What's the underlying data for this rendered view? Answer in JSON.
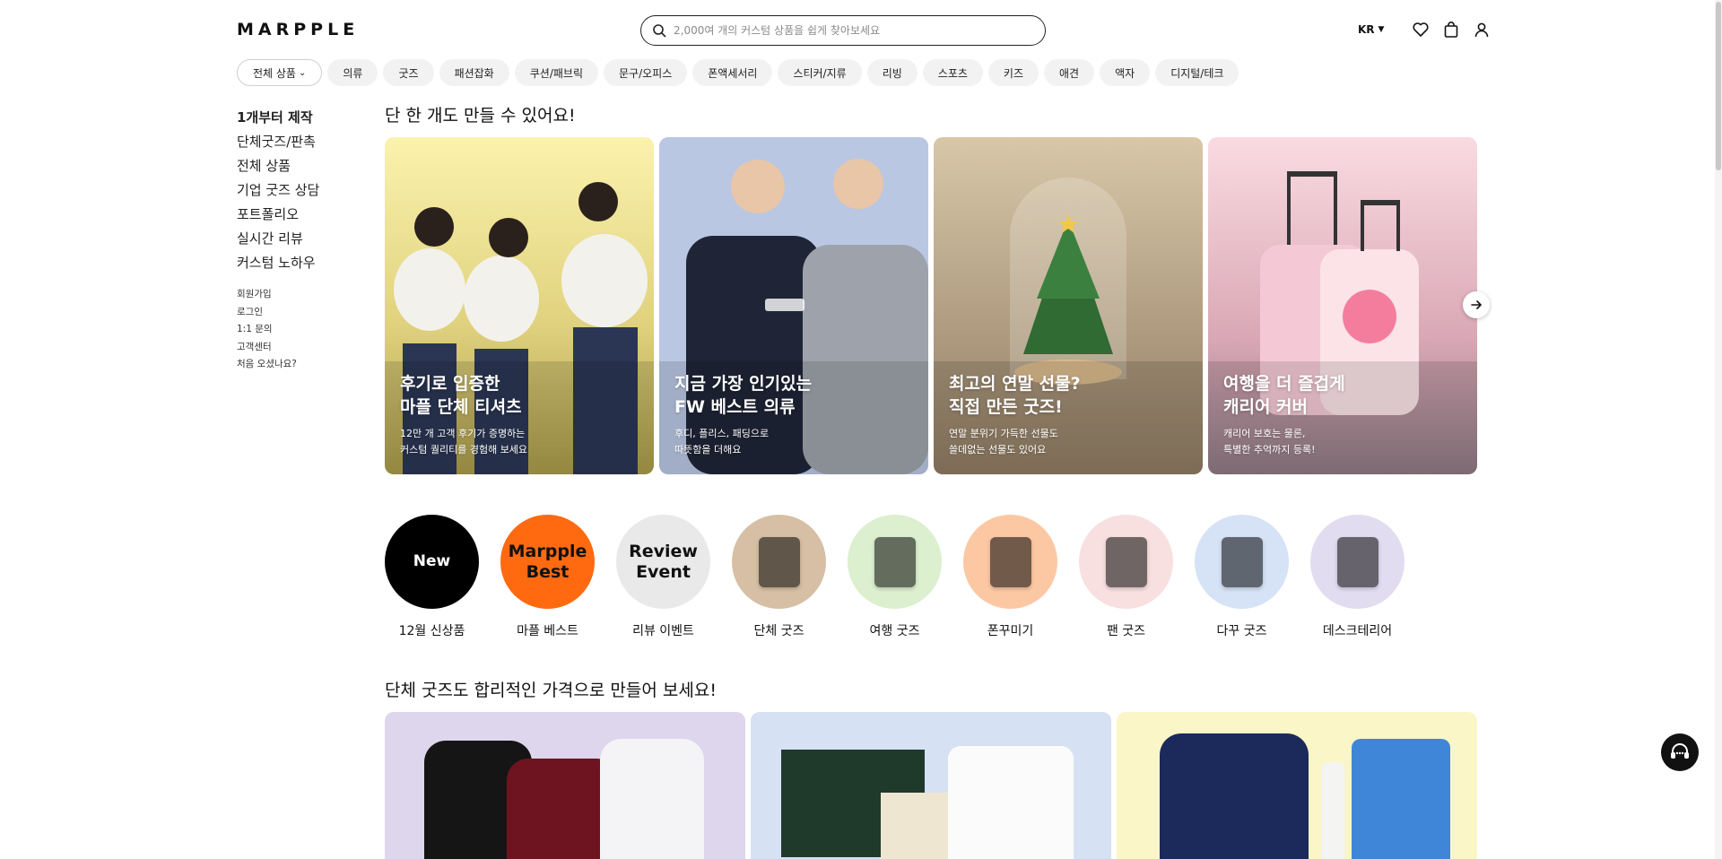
{
  "header": {
    "logo": "MARPPLE",
    "search_placeholder": "2,000여 개의 커스텀 상품을 쉽게 찾아보세요",
    "lang": "KR"
  },
  "categories": {
    "all_label": "전체 상품",
    "items": [
      "의류",
      "굿즈",
      "패션잡화",
      "쿠션/패브릭",
      "문구/오피스",
      "폰액세서리",
      "스티커/지류",
      "리빙",
      "스포츠",
      "키즈",
      "애견",
      "액자",
      "디지털/테크"
    ]
  },
  "sidebar": {
    "main": [
      "1개부터 제작",
      "단체굿즈/판촉",
      "전체 상품",
      "기업 굿즈 상담",
      "포트폴리오",
      "실시간 리뷰",
      "커스텀 노하우"
    ],
    "sub": [
      "회원가입",
      "로그인",
      "1:1 문의",
      "고객센터",
      "처음 오셨나요?"
    ]
  },
  "section1": {
    "title": "단 한 개도 만들 수 있어요!",
    "banners": [
      {
        "heading": "후기로 입증한\n마플 단체 티셔츠",
        "desc": "12만 개 고객 후기가 증명하는\n커스텀 퀄리티를 경험해 보세요"
      },
      {
        "heading": "지금 가장 인기있는\nFW 베스트 의류",
        "desc": "후디, 플리스, 패딩으로\n따뜻함을 더해요"
      },
      {
        "heading": "최고의 연말 선물?\n직접 만든 굿즈!",
        "desc": "연말 분위기 가득한 선물도\n쓸데없는 선물도 있어요"
      },
      {
        "heading": "여행을 더 즐겁게\n캐리어 커버",
        "desc": "캐리어 보호는 물론,\n특별한 추억까지 등록!"
      }
    ]
  },
  "circles": [
    {
      "inner": "New",
      "label": "12월 신상품",
      "bg": "#000000",
      "fg": "#ffffff"
    },
    {
      "inner": "Marpple\nBest",
      "label": "마플 베스트",
      "bg": "#ff6a10",
      "fg": "#111111"
    },
    {
      "inner": "Review\nEvent",
      "label": "리뷰 이벤트",
      "bg": "#e9e9e9",
      "fg": "#111111"
    },
    {
      "inner": "",
      "label": "단체 굿즈",
      "bg": "#d6bfa4",
      "fg": "#111111"
    },
    {
      "inner": "",
      "label": "여행 굿즈",
      "bg": "#dcefcf",
      "fg": "#111111"
    },
    {
      "inner": "",
      "label": "폰꾸미기",
      "bg": "#fcc8a4",
      "fg": "#111111"
    },
    {
      "inner": "",
      "label": "팬 굿즈",
      "bg": "#f8dfe0",
      "fg": "#111111"
    },
    {
      "inner": "",
      "label": "다꾸 굿즈",
      "bg": "#d6e2f6",
      "fg": "#111111"
    },
    {
      "inner": "",
      "label": "데스크테리어",
      "bg": "#e2dcf1",
      "fg": "#111111"
    }
  ],
  "section2": {
    "title": "단체 굿즈도 합리적인 가격으로 만들어 보세요!"
  },
  "colors": {
    "card_bg_1": "#ddd6ec",
    "card_bg_2": "#d7e1f4",
    "card_bg_3": "#fbf6c7"
  }
}
